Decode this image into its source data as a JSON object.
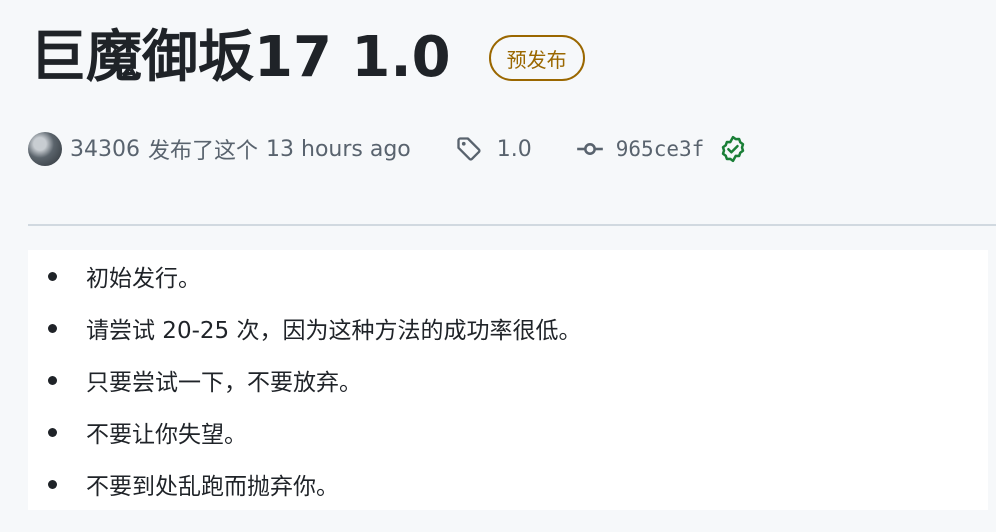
{
  "release": {
    "title": "巨魔御坂17 1.0",
    "badge": "预发布",
    "author": "34306",
    "action": "发布了这个",
    "time": "13 hours ago",
    "tag": "1.0",
    "commit": "965ce3f",
    "icons": {
      "avatar": "user-avatar",
      "tag": "tag-icon",
      "commit": "git-commit-icon",
      "verified": "verified-check-icon"
    },
    "colors": {
      "badge": "#9a6700",
      "verified": "#1a7f37",
      "muted": "#59636e"
    },
    "notes": [
      "初始发行。",
      "请尝试 20-25 次，因为这种方法的成功率很低。",
      "只要尝试一下，不要放弃。",
      "不要让你失望。",
      "不要到处乱跑而抛弃你。"
    ]
  }
}
